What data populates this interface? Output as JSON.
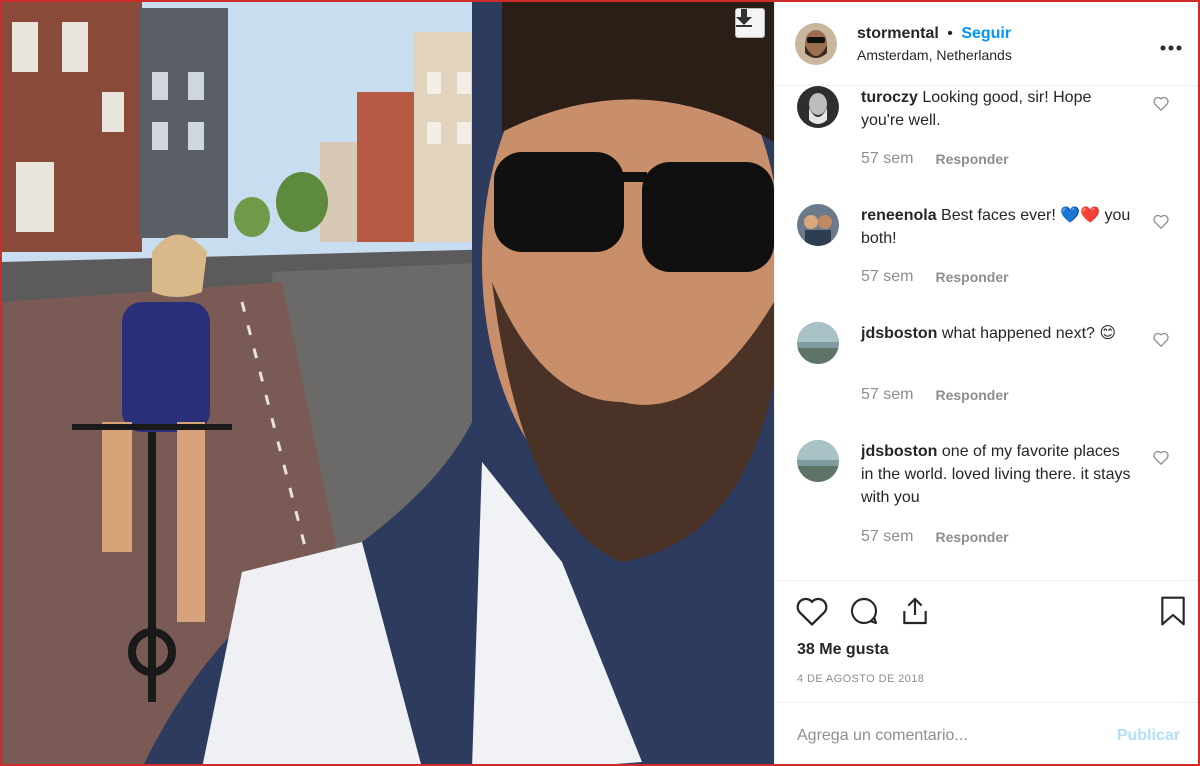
{
  "post": {
    "username": "stormental",
    "separator": "•",
    "follow_label": "Seguir",
    "location": "Amsterdam, Netherlands",
    "more_label": "•••"
  },
  "comments": [
    {
      "user": "turoczy",
      "text": "Looking good, sir! Hope you're well.",
      "time": "57 sem",
      "reply": "Responder"
    },
    {
      "user": "reneenola",
      "text": "Best faces ever! 💙❤️ you both!",
      "time": "57 sem",
      "reply": "Responder"
    },
    {
      "user": "jdsboston",
      "text": "what happened next? 😊",
      "time": "57 sem",
      "reply": "Responder"
    },
    {
      "user": "jdsboston",
      "text": "one of my favorite places in the world. loved living there. it stays with you",
      "time": "57 sem",
      "reply": "Responder"
    }
  ],
  "actions": {
    "icons": [
      "heart-icon",
      "comment-icon",
      "share-icon",
      "bookmark-icon"
    ],
    "likes": "38 Me gusta",
    "date": "4 DE AGOSTO DE 2018"
  },
  "comment_box": {
    "placeholder": "Agrega un comentario...",
    "publish_label": "Publicar"
  },
  "colors": {
    "accent": "#0095f6",
    "publish_disabled": "#b2dffc",
    "muted": "#8e8e8e",
    "text": "#262626",
    "frame_border": "#d02b2b"
  }
}
